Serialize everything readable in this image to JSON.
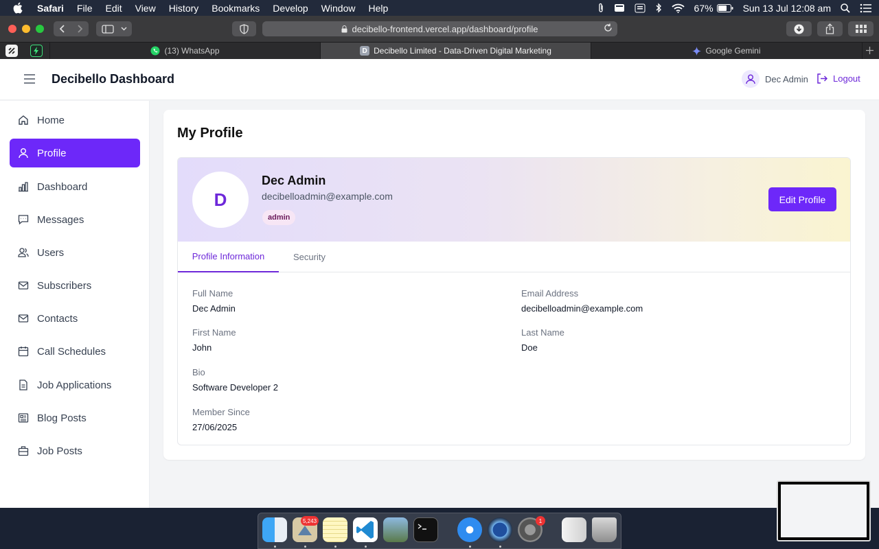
{
  "menubar": {
    "app_name": "Safari",
    "items": [
      "File",
      "Edit",
      "View",
      "History",
      "Bookmarks",
      "Develop",
      "Window",
      "Help"
    ],
    "battery": "67%",
    "clock": "Sun 13 Jul  12:08 am"
  },
  "browser": {
    "url": "decibello-frontend.vercel.app/dashboard/profile",
    "tabs": [
      {
        "label": "(13) WhatsApp"
      },
      {
        "label": "Decibello Limited - Data-Driven Digital Marketing",
        "favicon_letter": "D"
      },
      {
        "label": "Google Gemini"
      }
    ]
  },
  "header": {
    "brand": "Decibello Dashboard",
    "user_name": "Dec Admin",
    "logout_label": "Logout"
  },
  "sidebar": {
    "items": [
      {
        "label": "Home",
        "icon": "home-icon"
      },
      {
        "label": "Profile",
        "icon": "user-icon"
      },
      {
        "label": "Dashboard",
        "icon": "bar-chart-icon"
      },
      {
        "label": "Messages",
        "icon": "message-icon"
      },
      {
        "label": "Users",
        "icon": "users-icon"
      },
      {
        "label": "Subscribers",
        "icon": "mail-icon"
      },
      {
        "label": "Contacts",
        "icon": "mail-icon"
      },
      {
        "label": "Call Schedules",
        "icon": "calendar-icon"
      },
      {
        "label": "Job Applications",
        "icon": "file-icon"
      },
      {
        "label": "Blog Posts",
        "icon": "newspaper-icon"
      },
      {
        "label": "Job Posts",
        "icon": "briefcase-icon"
      }
    ],
    "active_index": 1
  },
  "profile": {
    "page_title": "My Profile",
    "avatar_letter": "D",
    "name": "Dec Admin",
    "email": "decibelloadmin@example.com",
    "role": "admin",
    "edit_label": "Edit Profile",
    "tabs": [
      "Profile Information",
      "Security"
    ],
    "active_tab": 0,
    "fields": {
      "full_name": {
        "label": "Full Name",
        "value": "Dec Admin"
      },
      "email": {
        "label": "Email Address",
        "value": "decibelloadmin@example.com"
      },
      "first_name": {
        "label": "First Name",
        "value": "John"
      },
      "last_name": {
        "label": "Last Name",
        "value": "Doe"
      },
      "bio": {
        "label": "Bio",
        "value": "Software Developer 2"
      },
      "member_since": {
        "label": "Member Since",
        "value": "27/06/2025"
      }
    }
  },
  "dock": {
    "mail_badge": "5,243",
    "settings_badge": "1"
  },
  "colors": {
    "accent": "#6d28f9",
    "accent_text": "#6d28d9",
    "role_badge_bg": "#f7e6f5"
  }
}
